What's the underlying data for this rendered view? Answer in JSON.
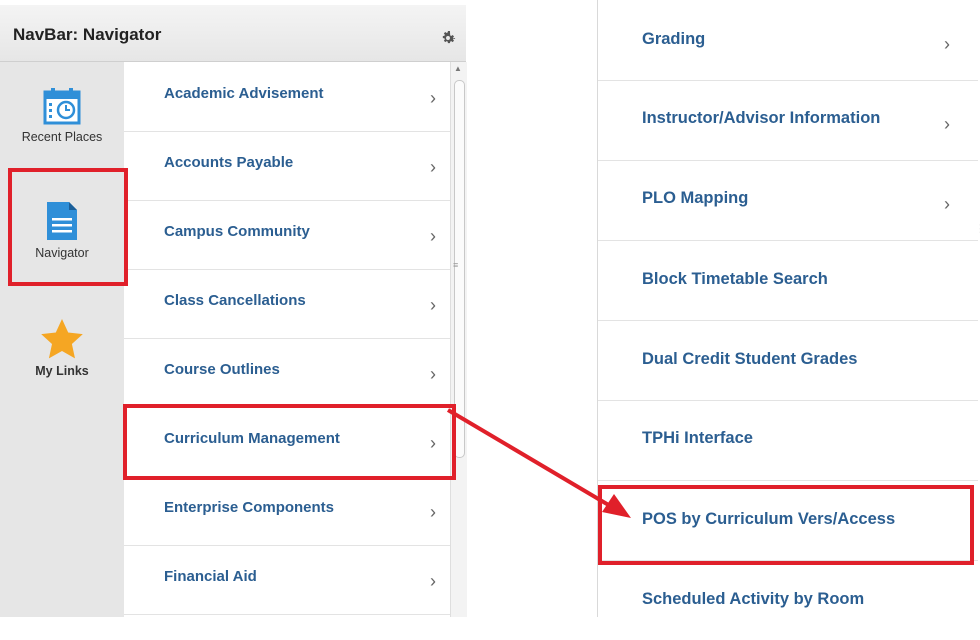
{
  "navbar": {
    "title": "NavBar: Navigator",
    "sidebar": [
      {
        "label": "Recent Places",
        "icon": "calendar-clock-icon"
      },
      {
        "label": "Navigator",
        "icon": "document-icon"
      },
      {
        "label": "My Links",
        "icon": "star-icon"
      }
    ],
    "items": [
      {
        "label": "Academic Advisement"
      },
      {
        "label": "Accounts Payable"
      },
      {
        "label": "Campus Community"
      },
      {
        "label": "Class Cancellations"
      },
      {
        "label": "Course Outlines"
      },
      {
        "label": "Curriculum Management"
      },
      {
        "label": "Enterprise Components"
      },
      {
        "label": "Financial Aid"
      }
    ]
  },
  "submenu": {
    "items": [
      {
        "label": "Grading",
        "has_children": true
      },
      {
        "label": "Instructor/Advisor Information",
        "has_children": true
      },
      {
        "label": "PLO Mapping",
        "has_children": true
      },
      {
        "label": "Block Timetable Search",
        "has_children": false
      },
      {
        "label": "Dual Credit Student Grades",
        "has_children": false
      },
      {
        "label": "TPHi Interface",
        "has_children": false
      },
      {
        "label": "POS by Curriculum Vers/Access",
        "has_children": false
      },
      {
        "label": "Scheduled Activity by Room",
        "has_children": false
      }
    ]
  },
  "colors": {
    "link": "#2b5e91",
    "highlight": "#e0202a",
    "star": "#f5a623",
    "icon_blue": "#2f8fd8"
  }
}
